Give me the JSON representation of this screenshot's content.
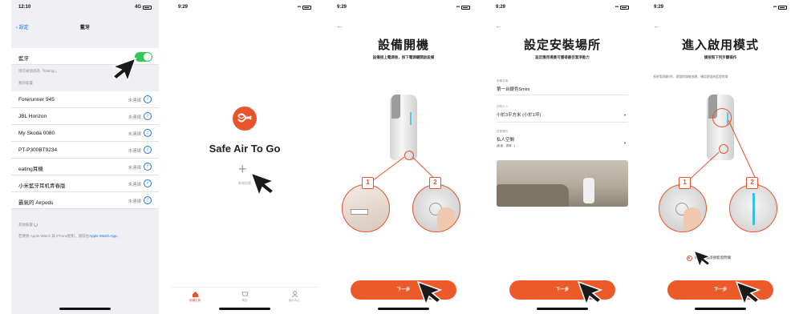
{
  "colors": {
    "accent": "#ec5a2a",
    "ios_blue": "#1a73e8",
    "toggle_green": "#34c759"
  },
  "phone1": {
    "status": {
      "time": "12:10",
      "network": "4G"
    },
    "nav": {
      "back": "設定",
      "title": "藍牙"
    },
    "bluetooth_label": "藍牙",
    "discoverable_text": "現可被偵測為「Eating」。",
    "my_devices_header": "我的裝置",
    "devices": [
      {
        "name": "Forerunner 945",
        "status": "未連線"
      },
      {
        "name": "JBL Horizon",
        "status": "未連線"
      },
      {
        "name": "My Skoda 0080",
        "status": "未連線"
      },
      {
        "name": "PT-P300BT9234",
        "status": "未連線"
      },
      {
        "name": "eating耳機",
        "status": "未連線"
      },
      {
        "name": "小米藍牙耳机青春版",
        "status": "未連線"
      },
      {
        "name": "霸氣的 Airpods",
        "status": "未連線"
      }
    ],
    "other_devices_header": "其他裝置",
    "watch_note_prefix": "若要將 Apple Watch 與 iPhone配對，請前往",
    "watch_note_link": "Apple Watch App",
    "watch_note_suffix": "。"
  },
  "phone2": {
    "status": {
      "time": "9:29"
    },
    "brand_name": "Safe Air To Go",
    "add_device_label": "新增設備",
    "tabs": [
      {
        "label": "設備主頁",
        "icon": "home-icon"
      },
      {
        "label": "商店",
        "icon": "shop-icon"
      },
      {
        "label": "個人中心",
        "icon": "profile-icon"
      }
    ]
  },
  "phone3": {
    "status": {
      "time": "9:29"
    },
    "title": "設備開機",
    "subtitle": "設備接上電源後，按下電源鍵開啟設備",
    "badge1": "1",
    "badge2": "2",
    "next_button": "下一步"
  },
  "phone4": {
    "status": {
      "time": "9:29"
    },
    "title": "設定安裝場所",
    "subtitle": "設定應用場景可獲得最佳潔淨能力",
    "fields": [
      {
        "label": "設備名稱",
        "value": "第一台銀色Smini"
      },
      {
        "label": "空間大小",
        "value": "小於3平方米 (小於1坪)"
      },
      {
        "label": "放置場所",
        "value": "私人空間",
        "hint": "(臥室、書房...)"
      }
    ],
    "next_button": "下一步"
  },
  "phone5": {
    "status": {
      "time": "9:29"
    },
    "title": "進入啟用模式",
    "subtitle": "請按照下列步驟操作",
    "instruction": "長按電源鍵5秒，燈號閃爍後放開，確認燈號為藍燈閃爍",
    "badge1": "1",
    "badge2": "2",
    "confirm_label": "確認設備燈號藍燈閃爍",
    "next_button": "下一步"
  }
}
